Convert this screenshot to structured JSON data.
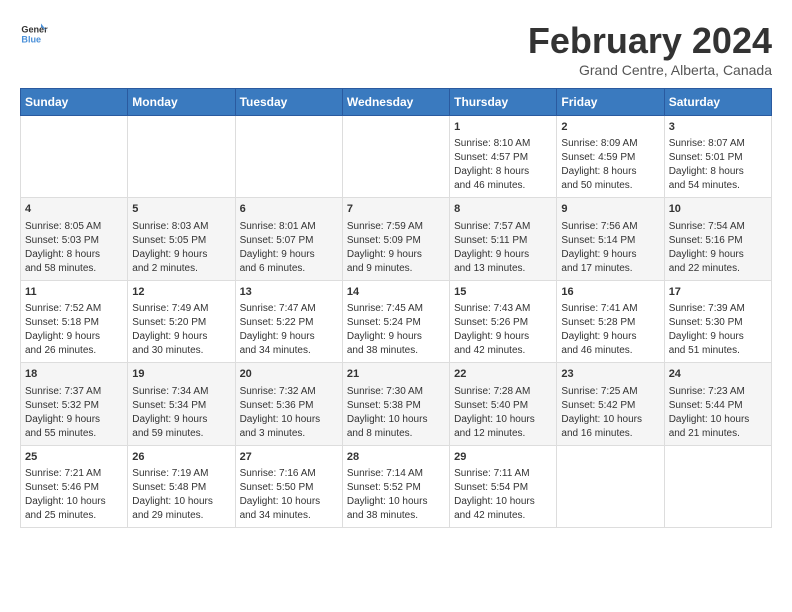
{
  "header": {
    "logo_line1": "General",
    "logo_line2": "Blue",
    "title": "February 2024",
    "subtitle": "Grand Centre, Alberta, Canada"
  },
  "days_of_week": [
    "Sunday",
    "Monday",
    "Tuesday",
    "Wednesday",
    "Thursday",
    "Friday",
    "Saturday"
  ],
  "weeks": [
    [
      {
        "day": "",
        "content": ""
      },
      {
        "day": "",
        "content": ""
      },
      {
        "day": "",
        "content": ""
      },
      {
        "day": "",
        "content": ""
      },
      {
        "day": "1",
        "content": "Sunrise: 8:10 AM\nSunset: 4:57 PM\nDaylight: 8 hours\nand 46 minutes."
      },
      {
        "day": "2",
        "content": "Sunrise: 8:09 AM\nSunset: 4:59 PM\nDaylight: 8 hours\nand 50 minutes."
      },
      {
        "day": "3",
        "content": "Sunrise: 8:07 AM\nSunset: 5:01 PM\nDaylight: 8 hours\nand 54 minutes."
      }
    ],
    [
      {
        "day": "4",
        "content": "Sunrise: 8:05 AM\nSunset: 5:03 PM\nDaylight: 8 hours\nand 58 minutes."
      },
      {
        "day": "5",
        "content": "Sunrise: 8:03 AM\nSunset: 5:05 PM\nDaylight: 9 hours\nand 2 minutes."
      },
      {
        "day": "6",
        "content": "Sunrise: 8:01 AM\nSunset: 5:07 PM\nDaylight: 9 hours\nand 6 minutes."
      },
      {
        "day": "7",
        "content": "Sunrise: 7:59 AM\nSunset: 5:09 PM\nDaylight: 9 hours\nand 9 minutes."
      },
      {
        "day": "8",
        "content": "Sunrise: 7:57 AM\nSunset: 5:11 PM\nDaylight: 9 hours\nand 13 minutes."
      },
      {
        "day": "9",
        "content": "Sunrise: 7:56 AM\nSunset: 5:14 PM\nDaylight: 9 hours\nand 17 minutes."
      },
      {
        "day": "10",
        "content": "Sunrise: 7:54 AM\nSunset: 5:16 PM\nDaylight: 9 hours\nand 22 minutes."
      }
    ],
    [
      {
        "day": "11",
        "content": "Sunrise: 7:52 AM\nSunset: 5:18 PM\nDaylight: 9 hours\nand 26 minutes."
      },
      {
        "day": "12",
        "content": "Sunrise: 7:49 AM\nSunset: 5:20 PM\nDaylight: 9 hours\nand 30 minutes."
      },
      {
        "day": "13",
        "content": "Sunrise: 7:47 AM\nSunset: 5:22 PM\nDaylight: 9 hours\nand 34 minutes."
      },
      {
        "day": "14",
        "content": "Sunrise: 7:45 AM\nSunset: 5:24 PM\nDaylight: 9 hours\nand 38 minutes."
      },
      {
        "day": "15",
        "content": "Sunrise: 7:43 AM\nSunset: 5:26 PM\nDaylight: 9 hours\nand 42 minutes."
      },
      {
        "day": "16",
        "content": "Sunrise: 7:41 AM\nSunset: 5:28 PM\nDaylight: 9 hours\nand 46 minutes."
      },
      {
        "day": "17",
        "content": "Sunrise: 7:39 AM\nSunset: 5:30 PM\nDaylight: 9 hours\nand 51 minutes."
      }
    ],
    [
      {
        "day": "18",
        "content": "Sunrise: 7:37 AM\nSunset: 5:32 PM\nDaylight: 9 hours\nand 55 minutes."
      },
      {
        "day": "19",
        "content": "Sunrise: 7:34 AM\nSunset: 5:34 PM\nDaylight: 9 hours\nand 59 minutes."
      },
      {
        "day": "20",
        "content": "Sunrise: 7:32 AM\nSunset: 5:36 PM\nDaylight: 10 hours\nand 3 minutes."
      },
      {
        "day": "21",
        "content": "Sunrise: 7:30 AM\nSunset: 5:38 PM\nDaylight: 10 hours\nand 8 minutes."
      },
      {
        "day": "22",
        "content": "Sunrise: 7:28 AM\nSunset: 5:40 PM\nDaylight: 10 hours\nand 12 minutes."
      },
      {
        "day": "23",
        "content": "Sunrise: 7:25 AM\nSunset: 5:42 PM\nDaylight: 10 hours\nand 16 minutes."
      },
      {
        "day": "24",
        "content": "Sunrise: 7:23 AM\nSunset: 5:44 PM\nDaylight: 10 hours\nand 21 minutes."
      }
    ],
    [
      {
        "day": "25",
        "content": "Sunrise: 7:21 AM\nSunset: 5:46 PM\nDaylight: 10 hours\nand 25 minutes."
      },
      {
        "day": "26",
        "content": "Sunrise: 7:19 AM\nSunset: 5:48 PM\nDaylight: 10 hours\nand 29 minutes."
      },
      {
        "day": "27",
        "content": "Sunrise: 7:16 AM\nSunset: 5:50 PM\nDaylight: 10 hours\nand 34 minutes."
      },
      {
        "day": "28",
        "content": "Sunrise: 7:14 AM\nSunset: 5:52 PM\nDaylight: 10 hours\nand 38 minutes."
      },
      {
        "day": "29",
        "content": "Sunrise: 7:11 AM\nSunset: 5:54 PM\nDaylight: 10 hours\nand 42 minutes."
      },
      {
        "day": "",
        "content": ""
      },
      {
        "day": "",
        "content": ""
      }
    ]
  ]
}
